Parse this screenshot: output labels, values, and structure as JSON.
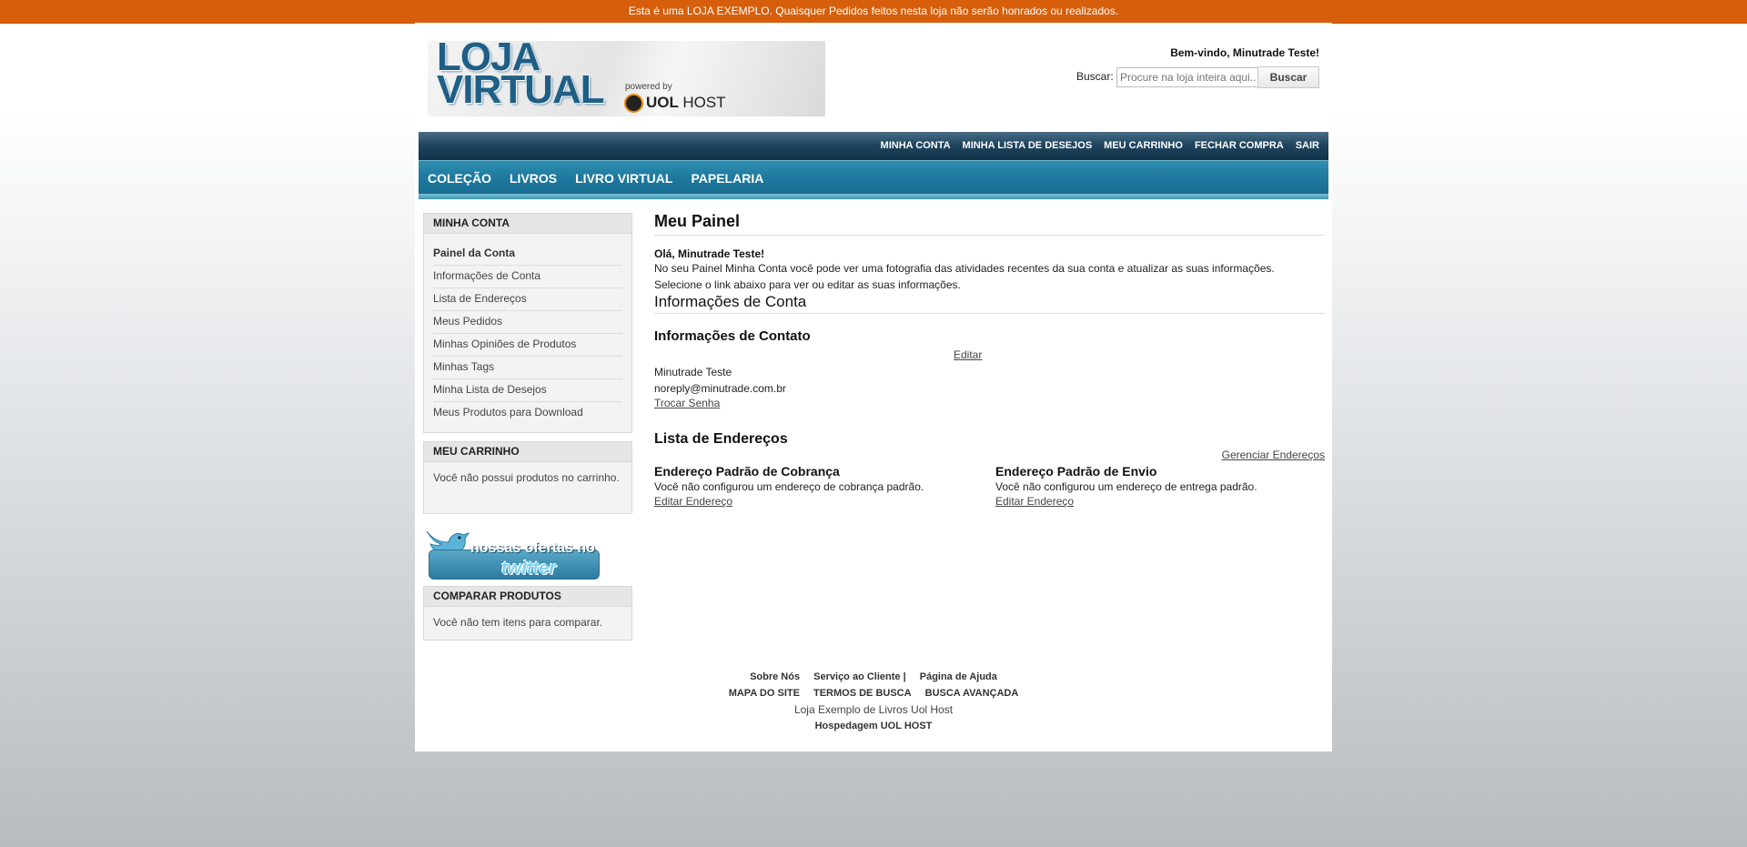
{
  "notice": "Esta é uma LOJA EXEMPLO. Quaisquer Pedidos feitos nesta loja não serão honrados ou realizados.",
  "header": {
    "logo_text_line1": "LOJA",
    "logo_text_line2": "VIRTUAL",
    "logo_powered": "powered by",
    "logo_brand": "UOL",
    "logo_brand_suffix": "HOST",
    "welcome": "Bem-vindo, Minutrade Teste!",
    "search_label": "Buscar:",
    "search_placeholder": "Procure na loja inteira aqui...",
    "search_button": "Buscar"
  },
  "top_links": [
    "MINHA CONTA",
    "MINHA LISTA DE DESEJOS",
    "MEU CARRINHO",
    "FECHAR COMPRA",
    "SAIR"
  ],
  "main_nav": [
    "COLEÇÃO",
    "LIVROS",
    "LIVRO VIRTUAL",
    "PAPELARIA"
  ],
  "sidebar": {
    "account_title": "MINHA CONTA",
    "account_items": [
      "Painel da Conta",
      "Informações de Conta",
      "Lista de Endereços",
      "Meus Pedidos",
      "Minhas Opiniões de Produtos",
      "Minhas Tags",
      "Minha Lista de Desejos",
      "Meus Produtos para Download"
    ],
    "cart_title": "MEU CARRINHO",
    "cart_text": "Você não possui produtos no carrinho.",
    "twitter_line1": "nossas ofertas no",
    "twitter_line2": "twitter",
    "compare_title": "COMPARAR PRODUTOS",
    "compare_text": "Você não tem itens para comparar."
  },
  "main": {
    "title": "Meu Painel",
    "hello": "Olá, Minutrade Teste!",
    "intro": "No seu Painel Minha Conta você pode ver uma fotografia das atividades recentes da sua conta e atualizar as suas informações. Selecione o link abaixo para ver ou editar as suas informações.",
    "account_info_title": "Informações de Conta",
    "contact_title": "Informações de Contato",
    "edit_link": "Editar",
    "contact_name": "Minutrade Teste",
    "contact_email": "noreply@minutrade.com.br",
    "change_password": "Trocar Senha",
    "address_book_title": "Lista de Endereços",
    "manage_addresses": "Gerenciar Endereços",
    "billing_title": "Endereço Padrão de Cobrança",
    "billing_text": "Você não configurou um endereço de cobrança padrão.",
    "billing_edit": "Editar Endereço",
    "shipping_title": "Endereço Padrão de Envio",
    "shipping_text": "Você não configurou um endereço de entrega padrão.",
    "shipping_edit": "Editar Endereço"
  },
  "footer": {
    "row1": [
      "Sobre Nós",
      "Serviço ao Cliente |",
      "Página de Ajuda"
    ],
    "row2": [
      "MAPA DO SITE",
      "TERMOS DE BUSCA",
      "BUSCA AVANÇADA"
    ],
    "store_name": "Loja Exemplo de Livros Uol Host",
    "hosting": "Hospedagem UOL HOST"
  },
  "colors": {
    "notice_bar": "#d75f0b",
    "top_links_bar": "#1f4560",
    "main_nav_bar": "#1f7aa0"
  }
}
